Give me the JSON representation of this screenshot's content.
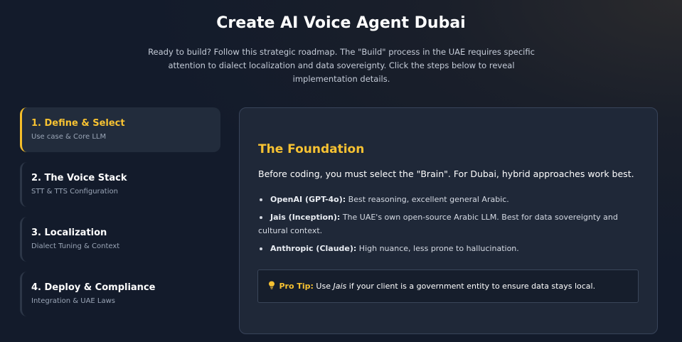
{
  "header": {
    "title": "Create AI Voice Agent Dubai",
    "intro": "Ready to build? Follow this strategic roadmap. The \"Build\" process in the UAE requires specific attention to dialect localization and data sovereignty. Click the steps below to reveal implementation details."
  },
  "steps": [
    {
      "title": "1. Define & Select",
      "subtitle": "Use case & Core LLM",
      "active": true
    },
    {
      "title": "2. The Voice Stack",
      "subtitle": "STT & TTS Configuration",
      "active": false
    },
    {
      "title": "3. Localization",
      "subtitle": "Dialect Tuning & Context",
      "active": false
    },
    {
      "title": "4. Deploy & Compliance",
      "subtitle": "Integration & UAE Laws",
      "active": false
    }
  ],
  "panel": {
    "heading": "The Foundation",
    "lead": "Before coding, you must select the \"Brain\". For Dubai, hybrid approaches work best.",
    "bullets": [
      {
        "label": "OpenAI (GPT-4o):",
        "text": "Best reasoning, excellent general Arabic."
      },
      {
        "label": "Jais (Inception):",
        "text": "The UAE's own open-source Arabic LLM. Best for data sovereignty and",
        "text_cont": "cultural context."
      },
      {
        "label": "Anthropic (Claude):",
        "text": "High nuance, less prone to hallucination."
      }
    ],
    "tip": {
      "icon": "lightbulb-icon",
      "label": "Pro Tip:",
      "text_before": "Use",
      "emphasis": "Jais",
      "text_after": "if your client is a government entity to ensure data stays local."
    }
  },
  "colors": {
    "accent": "#f7c232",
    "background": "#131b2b",
    "panel": "#1f2838"
  }
}
